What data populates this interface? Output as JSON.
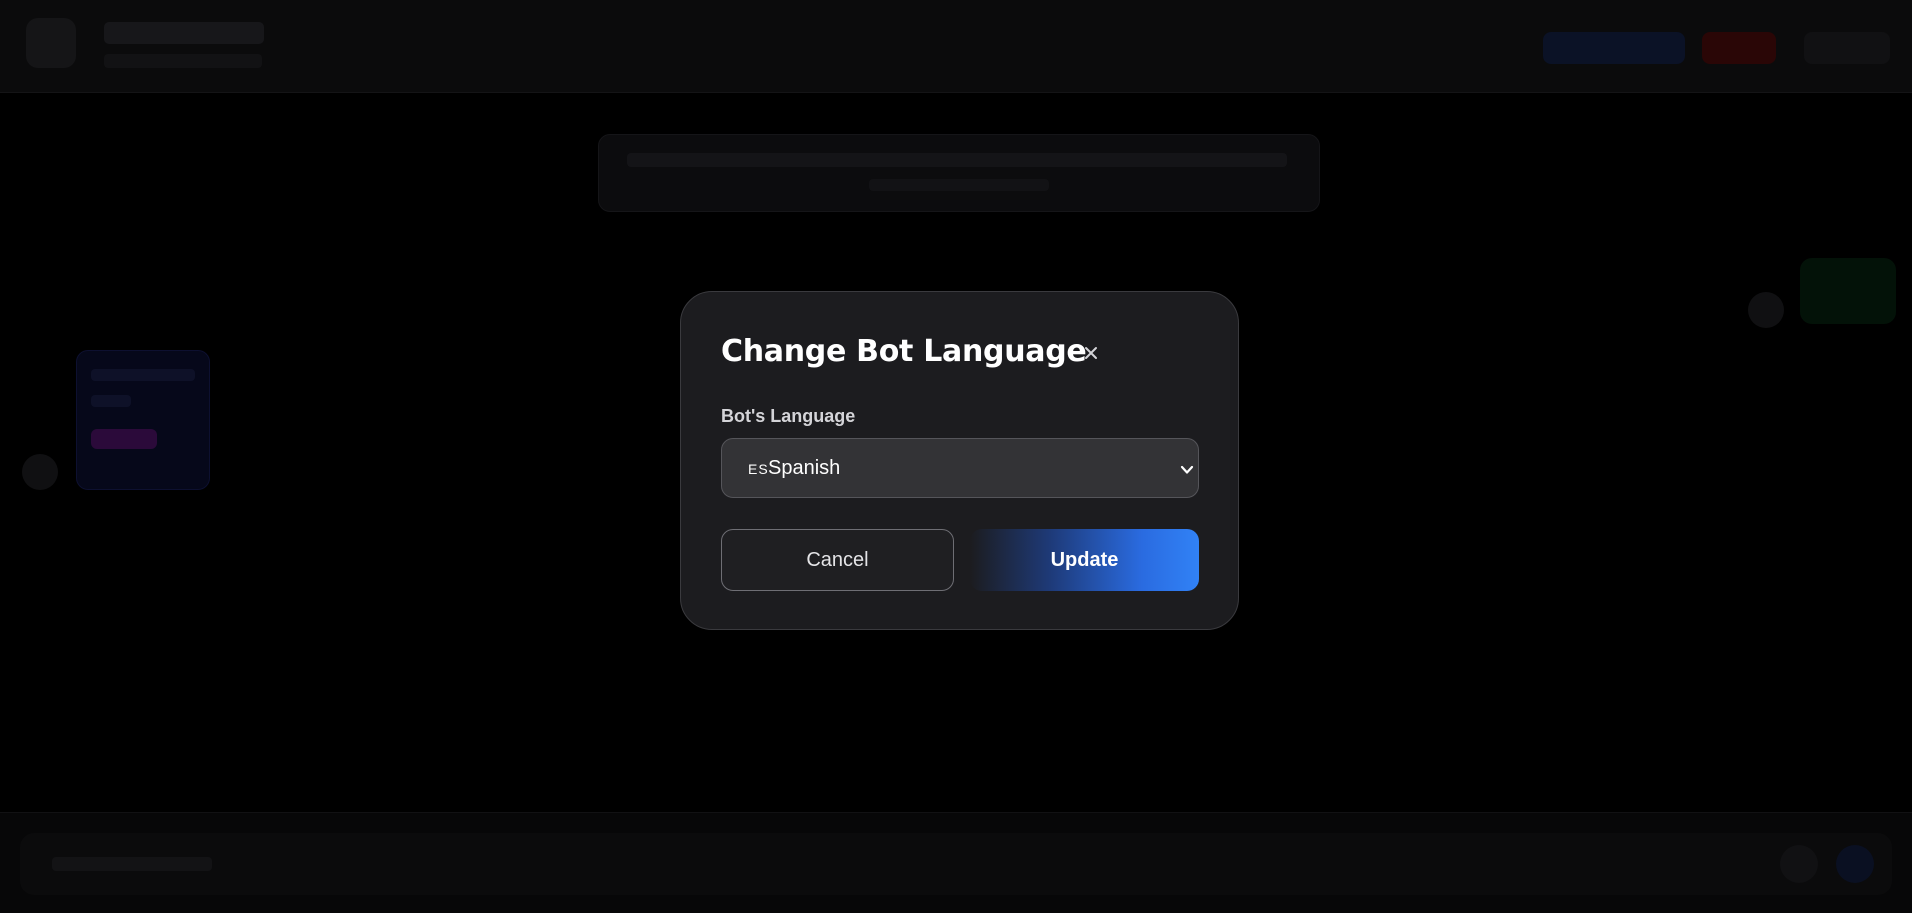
{
  "modal": {
    "title": "Change Bot Language",
    "close_icon": "close-icon",
    "field_label": "Bot's Language",
    "select": {
      "flag_code": "ES",
      "selected_value": "Spanish",
      "chevron_icon": "chevron-down-icon"
    },
    "cancel_label": "Cancel",
    "update_label": "Update"
  },
  "colors": {
    "page_background": "#000000",
    "modal_background": "#1c1c1f",
    "modal_border": "#3a3a3e",
    "select_background": "#333336",
    "update_gradient_end": "#3182f6",
    "text_primary": "#ffffff"
  }
}
